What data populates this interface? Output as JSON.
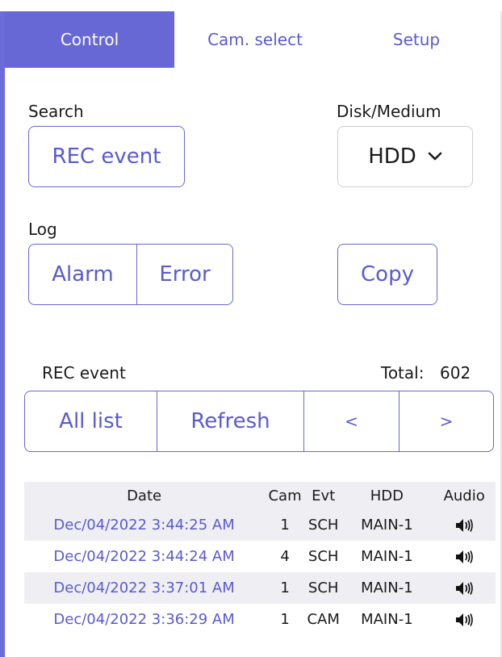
{
  "tabs": [
    {
      "label": "Control"
    },
    {
      "label": "Cam. select"
    },
    {
      "label": "Setup"
    }
  ],
  "search": {
    "label": "Search",
    "rec_event_button": "REC event"
  },
  "disk": {
    "label": "Disk/Medium",
    "selected": "HDD"
  },
  "log": {
    "label": "Log",
    "alarm_button": "Alarm",
    "error_button": "Error"
  },
  "copy_button": "Copy",
  "rec_event_section": {
    "title": "REC event",
    "total_label": "Total:",
    "total_value": "602",
    "buttons": {
      "all_list": "All list",
      "refresh": "Refresh",
      "prev": "<",
      "next": ">"
    }
  },
  "table": {
    "headers": {
      "date": "Date",
      "cam": "Cam",
      "evt": "Evt",
      "hdd": "HDD",
      "audio": "Audio"
    },
    "rows": [
      {
        "date": "Dec/04/2022 3:44:25 AM",
        "cam": "1",
        "evt": "SCH",
        "hdd": "MAIN-1"
      },
      {
        "date": "Dec/04/2022 3:44:24 AM",
        "cam": "4",
        "evt": "SCH",
        "hdd": "MAIN-1"
      },
      {
        "date": "Dec/04/2022 3:37:01 AM",
        "cam": "1",
        "evt": "SCH",
        "hdd": "MAIN-1"
      },
      {
        "date": "Dec/04/2022 3:36:29 AM",
        "cam": "1",
        "evt": "CAM",
        "hdd": "MAIN-1"
      }
    ]
  },
  "colors": {
    "accent": "#6767d6",
    "link": "#5a5ad1",
    "row_shade": "#efeff3"
  },
  "icons": {
    "disk_dropdown": "chevron-down-icon",
    "audio": "speaker-icon"
  }
}
